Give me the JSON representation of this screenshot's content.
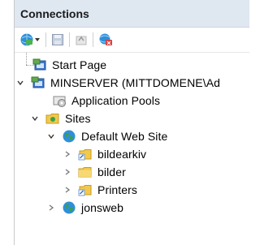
{
  "panel": {
    "title": "Connections"
  },
  "toolbar": {
    "items": [
      "connect-icon",
      "dropdown-arrow-icon",
      "save-icon",
      "up-icon",
      "disconnect-icon"
    ]
  },
  "tree": {
    "start_page": "Start Page",
    "server": "MINSERVER (MITTDOMENE\\Ad",
    "app_pools": "Application Pools",
    "sites": "Sites",
    "default_site": "Default Web Site",
    "bildearkiv": "bildearkiv",
    "bilder": "bilder",
    "printers": "Printers",
    "jonsweb": "jonsweb"
  },
  "colors": {
    "header_bg": "#dfe7f1",
    "globe": "#2e8b2e",
    "folder": "#f2c94c"
  }
}
